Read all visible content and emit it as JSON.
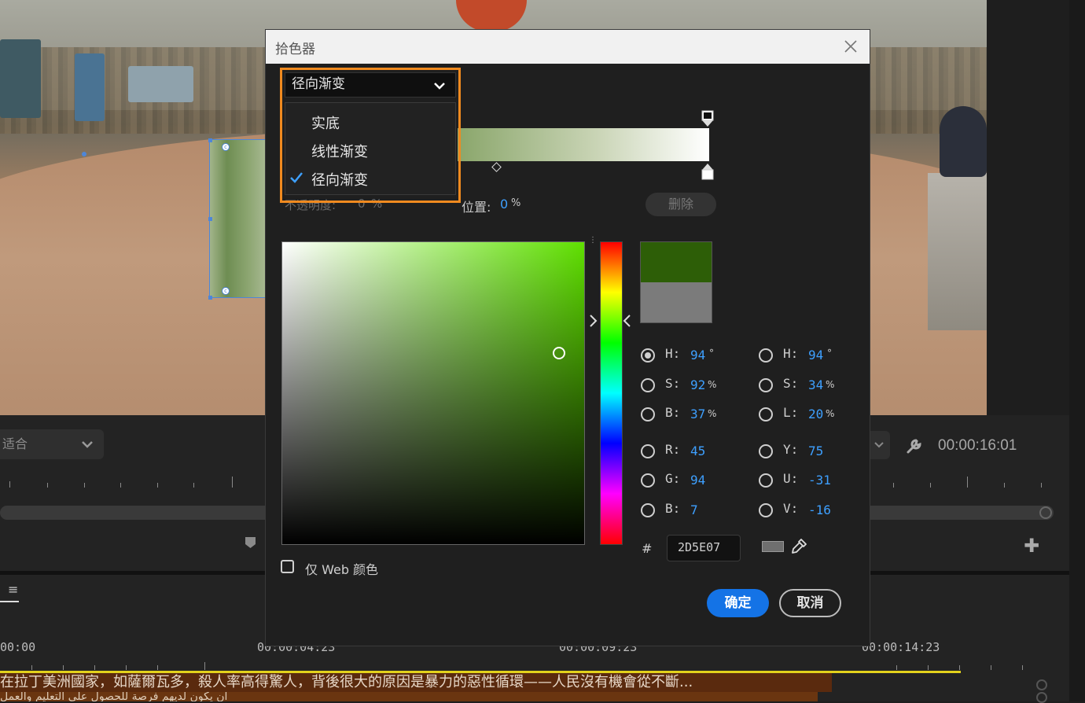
{
  "background": {
    "fit_dropdown": "适合",
    "timecode_right": "00:00:16:01",
    "timeline_times": [
      "00:00",
      "00:00:04:23",
      "00:00:09:23",
      "00:00:14:23"
    ],
    "caption_line_1": "在拉丁美洲國家，如薩爾瓦多，殺人率高得驚人，背後很大的原因是暴力的惡性循環——人民沒有機會從不斷...",
    "caption_line_2": "أن يكون لديهم فرصة للحصول على التعليم والعمل"
  },
  "dialog": {
    "title": "拾色器",
    "gradient_type_selected": "径向渐变",
    "gradient_type_options": [
      "实底",
      "线性渐变",
      "径向渐变"
    ],
    "opacity_label": "不透明度:",
    "opacity_value": "0",
    "opacity_unit": "%",
    "position_label": "位置:",
    "position_value": "0",
    "position_unit": "%",
    "delete_label": "删除",
    "new_color": "#2D5E07",
    "old_color": "#7B7B7B",
    "fields_left": [
      {
        "label": "H:",
        "value": "94",
        "unit": "°",
        "checked": true
      },
      {
        "label": "S:",
        "value": "92",
        "unit": "%",
        "checked": false
      },
      {
        "label": "B:",
        "value": "37",
        "unit": "%",
        "checked": false
      },
      {
        "label": "R:",
        "value": "45",
        "unit": "",
        "checked": false
      },
      {
        "label": "G:",
        "value": "94",
        "unit": "",
        "checked": false
      },
      {
        "label": "B:",
        "value": "7",
        "unit": "",
        "checked": false
      }
    ],
    "fields_right": [
      {
        "label": "H:",
        "value": "94",
        "unit": "°",
        "checked": false
      },
      {
        "label": "S:",
        "value": "34",
        "unit": "%",
        "checked": false
      },
      {
        "label": "L:",
        "value": "20",
        "unit": "%",
        "checked": false
      },
      {
        "label": "Y:",
        "value": "75",
        "unit": "",
        "checked": false
      },
      {
        "label": "U:",
        "value": "-31",
        "unit": "",
        "checked": false
      },
      {
        "label": "V:",
        "value": "-16",
        "unit": "",
        "checked": false
      }
    ],
    "hash_label": "#",
    "hex_value": "2D5E07",
    "web_only_label": "仅 Web 颜色",
    "ok_label": "确定",
    "cancel_label": "取消"
  }
}
